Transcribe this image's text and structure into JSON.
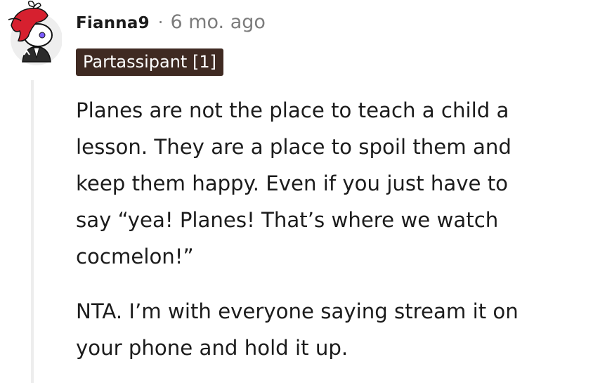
{
  "comment": {
    "author": "Fianna9",
    "separator": "·",
    "timestamp": "6 mo. ago",
    "flair": "Partassipant [1]",
    "paragraphs": [
      "Planes are not the place to teach a child a\nlesson. They are a place to spoil them and\nkeep them happy. Even if you just have to\nsay “yea! Planes! That’s where we watch\ncocmelon!”",
      "NTA. I’m with everyone saying stream it on\nyour phone and hold it up."
    ]
  },
  "colors": {
    "flair_background": "#3f2a22",
    "avatar_hair": "#d6202f",
    "thread_line": "#ededed"
  },
  "icons": {
    "avatar": "user-avatar-icon"
  }
}
